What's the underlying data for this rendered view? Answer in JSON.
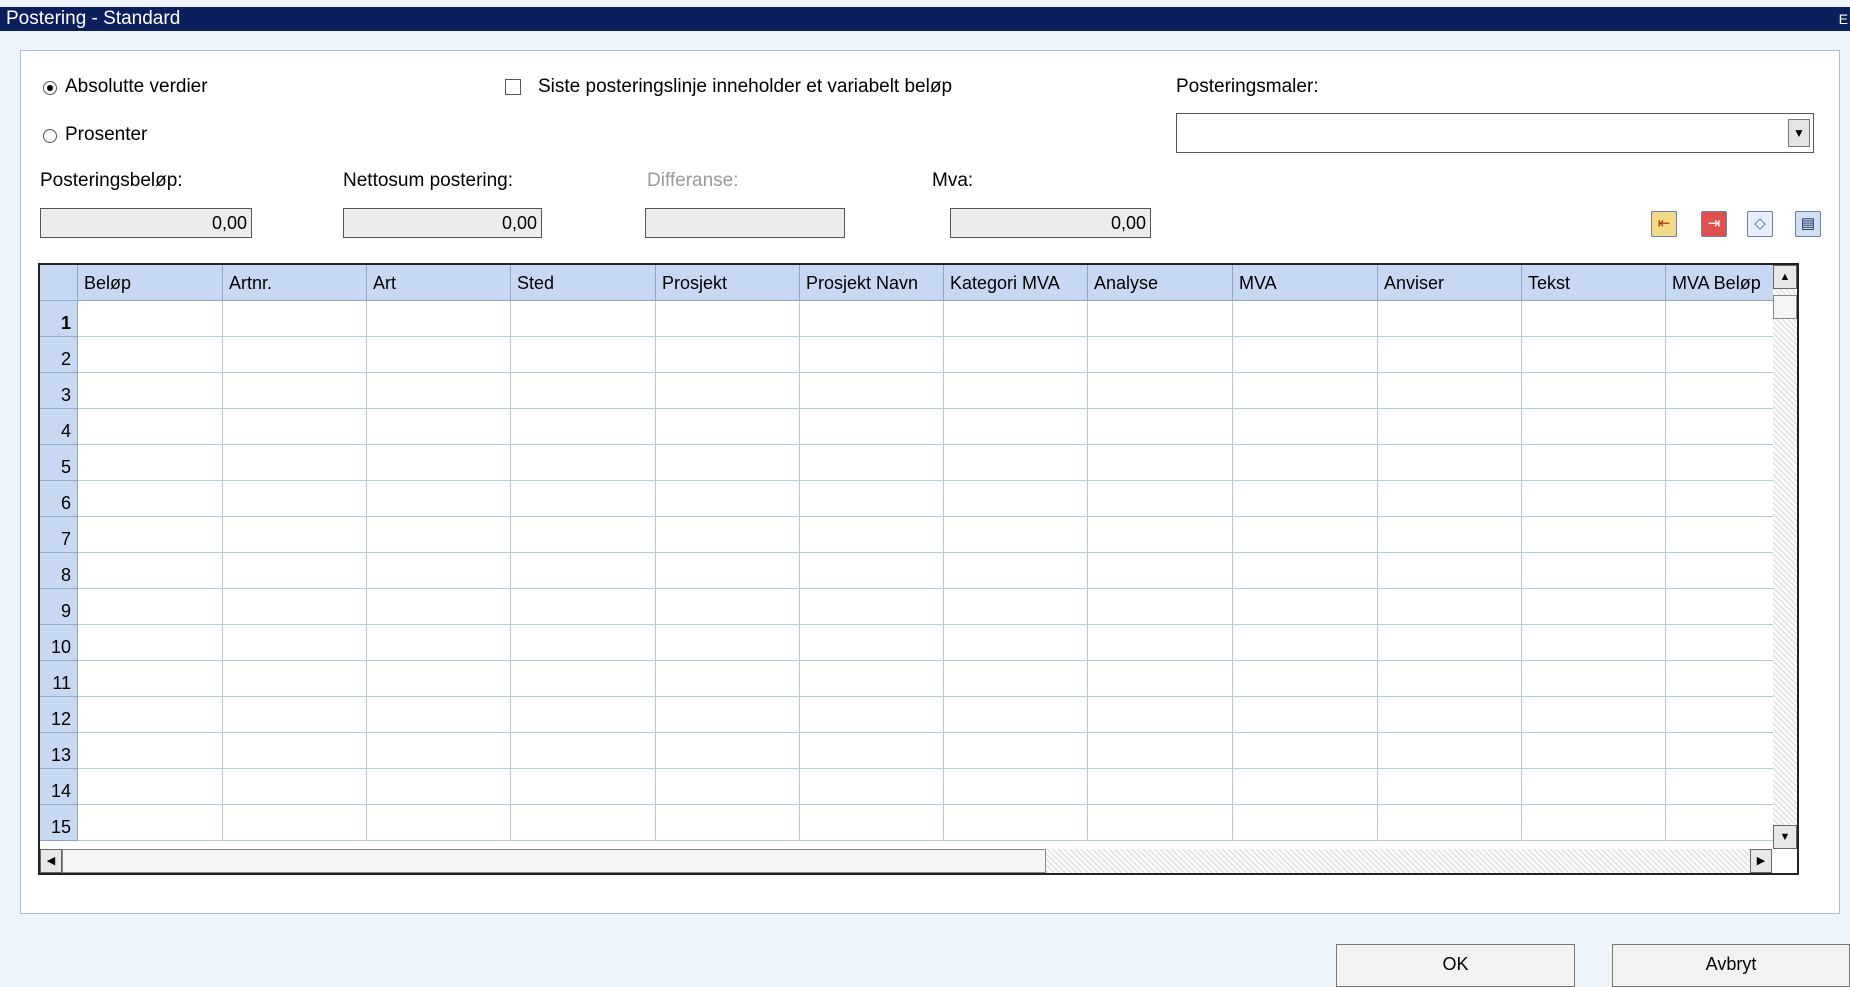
{
  "window": {
    "title": "Postering - Standard",
    "corner_glyph": "E"
  },
  "mode": {
    "absolute_label": "Absolutte verdier",
    "percent_label": "Prosenter",
    "selected": "absolute"
  },
  "variable_checkbox": {
    "label": "Siste posteringslinje inneholder et variabelt beløp",
    "checked": false
  },
  "templates": {
    "label": "Posteringsmaler:",
    "value": ""
  },
  "summary": {
    "posting_amount": {
      "label": "Posteringsbeløp:",
      "value": "0,00"
    },
    "net_sum": {
      "label": "Nettosum postering:",
      "value": "0,00"
    },
    "difference": {
      "label": "Differanse:",
      "value": ""
    },
    "vat": {
      "label": "Mva:",
      "value": "0,00"
    }
  },
  "toolbar_icons": [
    "import-icon",
    "export-icon",
    "eraser-icon",
    "print-icon"
  ],
  "grid": {
    "columns": [
      "Beløp",
      "Artnr.",
      "Art",
      "Sted",
      "Prosjekt",
      "Prosjekt Navn",
      "Kategori MVA",
      "Analyse",
      "MVA",
      "Anviser",
      "Tekst",
      "MVA Beløp"
    ],
    "rows": [
      "1",
      "2",
      "3",
      "4",
      "5",
      "6",
      "7",
      "8",
      "9",
      "10",
      "11",
      "12",
      "13",
      "14",
      "15"
    ]
  },
  "buttons": {
    "ok": "OK",
    "cancel": "Avbryt"
  }
}
